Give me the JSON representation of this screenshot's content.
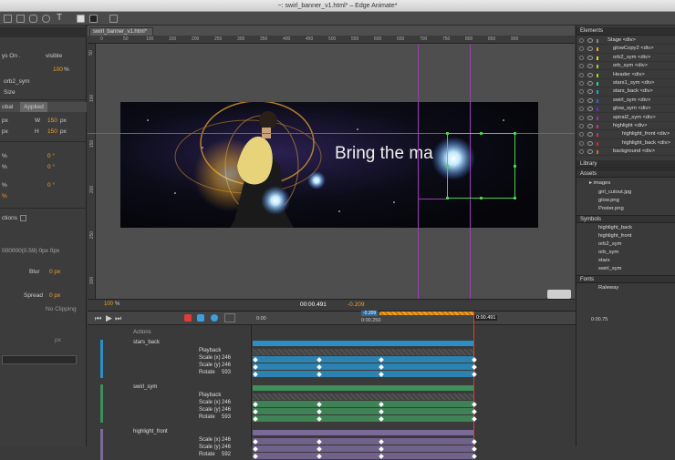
{
  "window": {
    "title": "~: swirl_banner_v1.html* – Edge Animate*"
  },
  "document": {
    "tab_label": "swirl_banner_v1.html*"
  },
  "ruler": {
    "h_ticks": [
      "0",
      "50",
      "100",
      "150",
      "200",
      "250",
      "300",
      "350",
      "400",
      "450",
      "500",
      "550",
      "600",
      "650",
      "700",
      "750",
      "800",
      "850",
      "900"
    ],
    "v_ticks": [
      "50",
      "100",
      "150",
      "200",
      "250",
      "300"
    ]
  },
  "stage": {
    "text": "Bring the ma",
    "zoom": "100",
    "zoom_unit": "%",
    "time": "00:00.491",
    "offset": "-0.209"
  },
  "left_panel": {
    "rows": [
      "ys On .",
      "visible",
      "100",
      "%",
      "orb2_sym",
      "Size",
      "obal",
      "Applied",
      "px",
      "W",
      "150",
      "px",
      "px",
      "H",
      "150",
      "px",
      "%",
      "0 °",
      "%",
      "0 °",
      "%",
      "0 °",
      "%",
      "ctions",
      "000000(0.59) 0px 0px",
      "Blur",
      "0 px",
      "Spread",
      "0 px",
      "No Clipping",
      "px"
    ]
  },
  "elements": {
    "title": "Elements",
    "items": [
      {
        "label": "Stage <div>",
        "color": "#888888"
      },
      {
        "label": "glowCopy2 <div>",
        "color": "#e5a72a"
      },
      {
        "label": "orb2_sym <div>",
        "color": "#e5d42a"
      },
      {
        "label": "orb_sym <div>",
        "color": "#9ad42a"
      },
      {
        "label": "Header <div>",
        "color": "#9ad42a"
      },
      {
        "label": "stars1_sym <div>",
        "color": "#2ad48a"
      },
      {
        "label": "stars_back <div>",
        "color": "#2aa0d4"
      },
      {
        "label": "swirl_sym <div>",
        "color": "#2a6ad4"
      },
      {
        "label": "glow_sym <div>",
        "color": "#6a2ad4"
      },
      {
        "label": "spiral2_sym <div>",
        "color": "#a02ad4"
      },
      {
        "label": "highlight <div>",
        "color": "#d42aa0"
      },
      {
        "label": "highlight_front <div>",
        "color": "#d42a6a"
      },
      {
        "label": "highlight_back <div>",
        "color": "#d42a2a"
      },
      {
        "label": "background <div>",
        "color": "#d46a2a"
      }
    ]
  },
  "library": {
    "title": "Library",
    "assets_label": "Assets",
    "images_label": "images",
    "images": [
      "girl_cutout.jpg",
      "glow.png",
      "Poster.png"
    ],
    "symbols_label": "Symbols",
    "symbols": [
      "highlight_back",
      "highlight_front",
      "orb2_sym",
      "orb_sym",
      "stars",
      "swirl_sym"
    ],
    "fonts_label": "Fonts",
    "fonts": [
      "Raleway"
    ]
  },
  "timeline": {
    "ruler": [
      "0:00",
      "0:00.250",
      "0:00.75"
    ],
    "current_time": "0:00.491",
    "range_start": "-0.209",
    "actions_label": "Actions",
    "groups": [
      {
        "name": "stars_back",
        "props": [
          {
            "n": "Playback",
            "v": ""
          },
          {
            "n": "Scale (x)",
            "v": "246"
          },
          {
            "n": "Scale (y)",
            "v": "246"
          },
          {
            "n": "Rotate",
            "v": "593"
          }
        ],
        "color": "#2a8fc7"
      },
      {
        "name": "swirl_sym",
        "props": [
          {
            "n": "Playback",
            "v": ""
          },
          {
            "n": "Scale (x)",
            "v": "246"
          },
          {
            "n": "Scale (y)",
            "v": "246"
          },
          {
            "n": "Rotate",
            "v": "593"
          }
        ],
        "color": "#3f8f5a"
      },
      {
        "name": "highlight_front",
        "props": [
          {
            "n": "Scale (x)",
            "v": "246"
          },
          {
            "n": "Scale (y)",
            "v": "246"
          },
          {
            "n": "Rotate",
            "v": "592"
          }
        ],
        "color": "#7a6a9a"
      }
    ]
  }
}
